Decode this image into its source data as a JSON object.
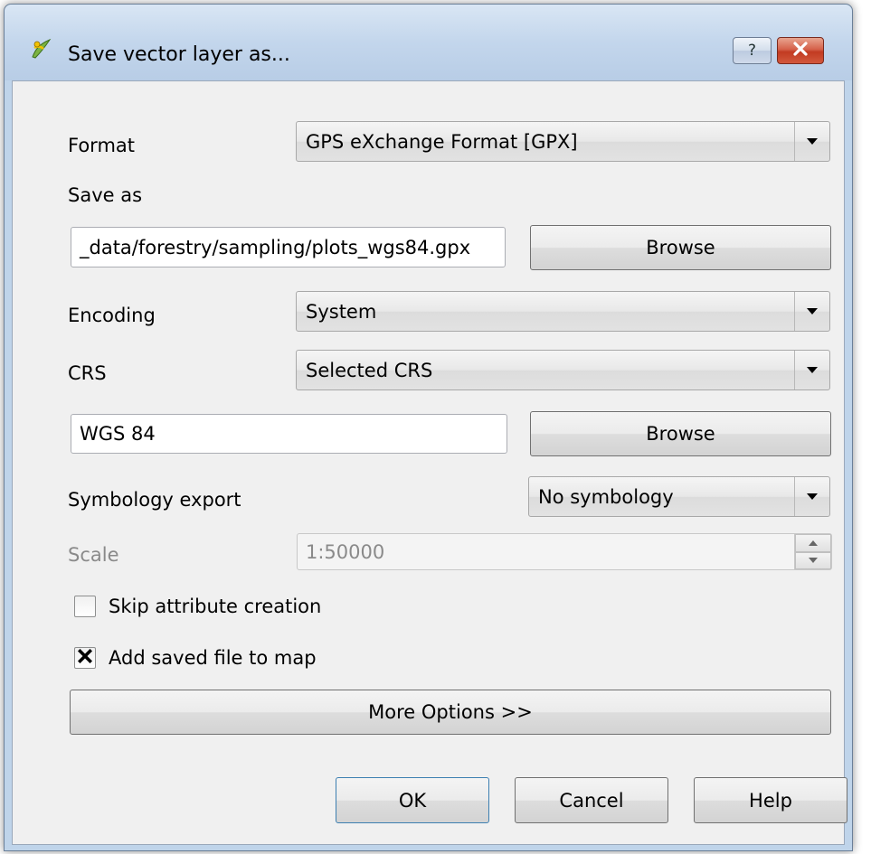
{
  "window": {
    "title": "Save vector layer as...",
    "help_label": "?",
    "icon": "qgis-icon",
    "close_icon": "close-icon"
  },
  "form": {
    "format_label": "Format",
    "format_value": "GPS eXchange Format [GPX]",
    "save_as_label": "Save as",
    "save_as_value": "_data/forestry/sampling/plots_wgs84.gpx",
    "browse_label": "Browse",
    "encoding_label": "Encoding",
    "encoding_value": "System",
    "crs_label": "CRS",
    "crs_value": "Selected CRS",
    "crs_name_value": "WGS 84",
    "crs_browse_label": "Browse",
    "symbology_label": "Symbology export",
    "symbology_value": "No symbology",
    "scale_label": "Scale",
    "scale_value": "1:50000",
    "skip_attr_label": "Skip attribute creation",
    "skip_attr_checked": false,
    "add_to_map_label": "Add saved file to map",
    "add_to_map_checked": true,
    "more_options_label": "More Options >>"
  },
  "buttons": {
    "ok": "OK",
    "cancel": "Cancel",
    "help": "Help"
  },
  "colors": {
    "titlebar": "#c3d6ec",
    "client_bg": "#f0f0f0",
    "close_button": "#c23b22",
    "disabled_text": "#8a8a8a"
  }
}
